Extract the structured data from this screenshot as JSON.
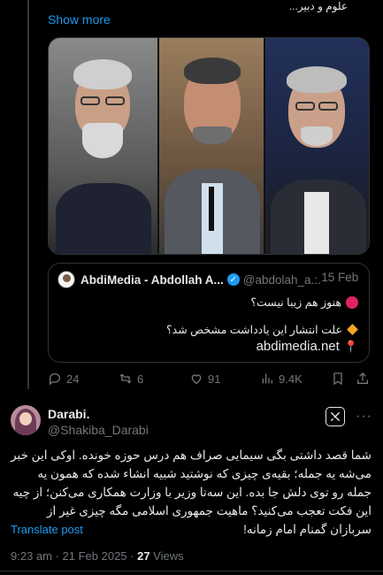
{
  "thread": {
    "truncated_text": "علوم و دبیر...",
    "show_more": "Show more"
  },
  "quote": {
    "name": "AbdiMedia - Abdollah A...",
    "handle": "@abdolah_a...",
    "date": "· 15 Feb",
    "line1": "هنوز هم زیبا نیست؟",
    "line2": "علت انتشار این یادداشت مشخص شد؟",
    "link": "abdimedia.net"
  },
  "actions": {
    "replies": "24",
    "reposts": "6",
    "likes": "91",
    "views": "9.4K"
  },
  "post": {
    "author_name": "Darabi.",
    "author_handle": "@Shakiba_Darabi",
    "text": "شما قصد داشتی بگی سیمایی صراف هم درس حوزه خونده. اوکی این خبر می‌شه یه جمله؛ بقیه‌ی چیزی که نوشتید شبیه انشاء شده که همون یه جمله رو توی دلش جا بده. این سه‌تا وزیر با وزارت همکاری می‌کنن؛ از چیه این فکت تعجب می‌کنید؟ ماهیت جمهوری اسلامی مگه چیزی غیر از سربازان گمنام امام زمانه!",
    "translate": "Translate post",
    "time": "9:23 am · 21 Feb 2025 · ",
    "views": "27",
    "views_label": " Views"
  },
  "icons": {
    "reply": "reply-icon",
    "repost": "repost-icon",
    "like": "heart-icon",
    "views": "views-icon",
    "bookmark": "bookmark-icon",
    "share": "share-icon",
    "grok": "grok-icon",
    "more": "more-icon"
  },
  "colors": {
    "background": "#000000",
    "accent": "#1d9bf0",
    "muted": "#71767b",
    "text": "#e7e9ea",
    "border": "#2f3336"
  }
}
